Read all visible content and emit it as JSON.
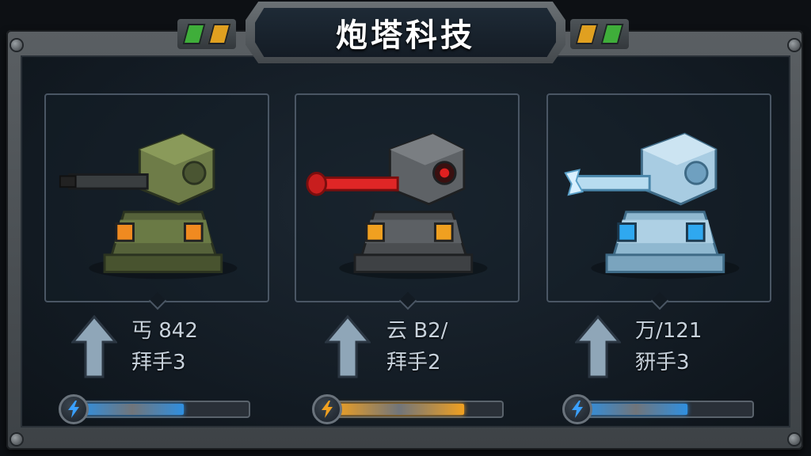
{
  "title": "炮塔科技",
  "colors": {
    "green_card": "#5c6a3a",
    "red_card": "#c62828",
    "ice_card": "#8fc7e6",
    "energy_blue": "#2f8fe0",
    "energy_orange": "#f0a020"
  },
  "header_lights": {
    "left": [
      "#3fae3a",
      "#e0a020"
    ],
    "right": [
      "#e0a020",
      "#3fae3a"
    ]
  },
  "turrets": [
    {
      "name_icon": "machine-gun-turret-icon",
      "stat_line_1": "丐 842",
      "stat_line_2": "拜手3",
      "energy_icon": "lightning-blue-icon",
      "energy_fraction": 0.62,
      "energy_color": "#2f8fe0"
    },
    {
      "name_icon": "laser-turret-icon",
      "stat_line_1": "云 B2/",
      "stat_line_2": "拜手2",
      "energy_icon": "lightning-orange-icon",
      "energy_fraction": 0.78,
      "energy_color": "#f0a020"
    },
    {
      "name_icon": "ice-turret-icon",
      "stat_line_1": "万/121",
      "stat_line_2": "豜手3",
      "energy_icon": "lightning-blue-icon",
      "energy_fraction": 0.62,
      "energy_color": "#2f8fe0"
    }
  ]
}
